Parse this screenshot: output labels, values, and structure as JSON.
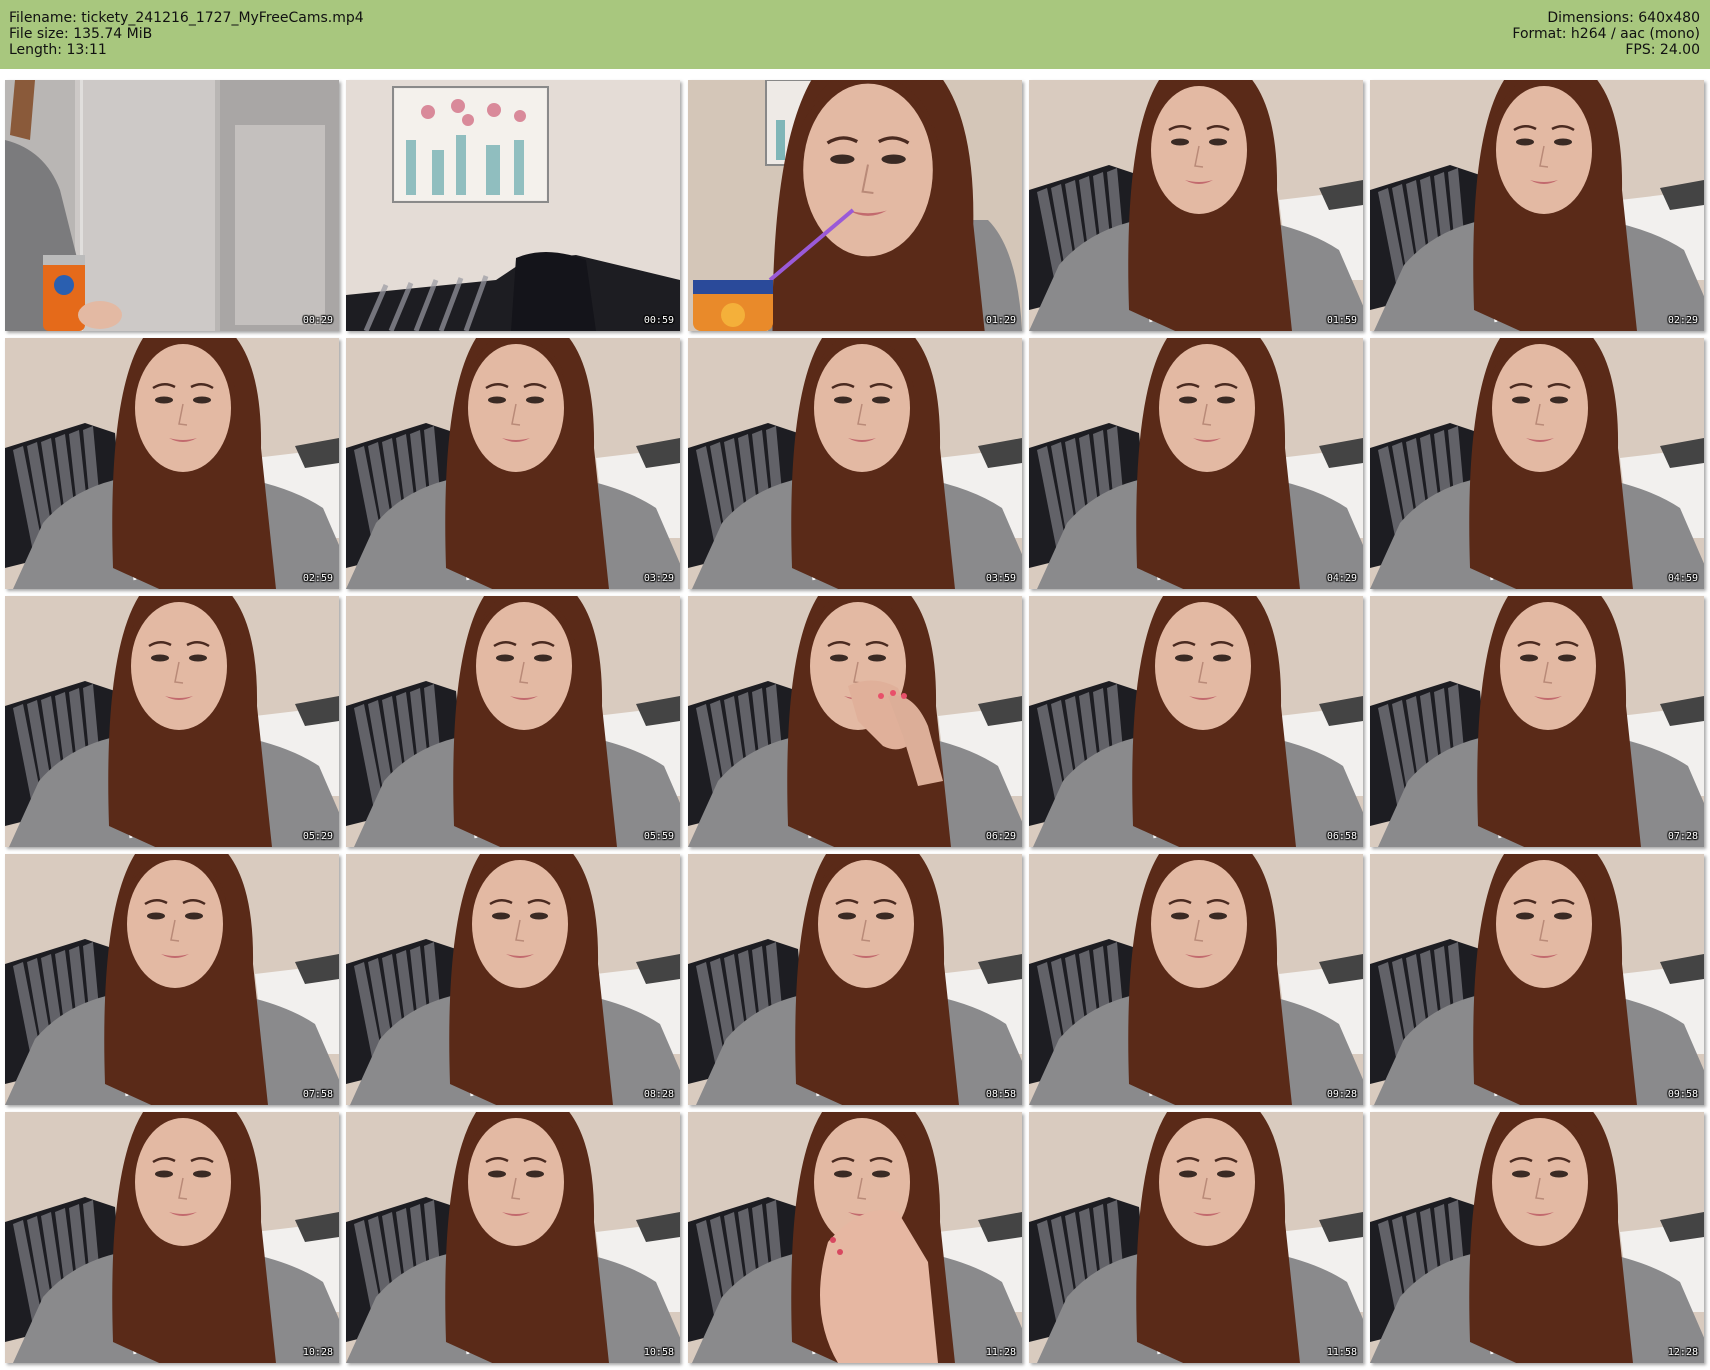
{
  "header": {
    "filename": "Filename: tickety_241216_1727_MyFreeCams.mp4",
    "filesize": "File size: 135.74 MiB",
    "length": "Length: 13:11",
    "dimensions": "Dimensions: 640x480",
    "format": "Format: h264 / aac (mono)",
    "fps": "FPS: 24.00"
  },
  "colors": {
    "header_bg": "#a8c77e",
    "wall": "#d9cbbf",
    "sofa": "#1d1d22",
    "hoodie": "#8a8a8c",
    "hair": "#5a2a18",
    "skin": "#e3b9a3"
  },
  "thumbnails": [
    {
      "time": "00:29",
      "scene": "arm-can"
    },
    {
      "time": "00:59",
      "scene": "room"
    },
    {
      "time": "01:29",
      "scene": "straw"
    },
    {
      "time": "01:59",
      "scene": "portrait"
    },
    {
      "time": "02:29",
      "scene": "portrait"
    },
    {
      "time": "02:59",
      "scene": "portrait"
    },
    {
      "time": "03:29",
      "scene": "portrait"
    },
    {
      "time": "03:59",
      "scene": "portrait"
    },
    {
      "time": "04:29",
      "scene": "portrait"
    },
    {
      "time": "04:59",
      "scene": "portrait"
    },
    {
      "time": "05:29",
      "scene": "portrait"
    },
    {
      "time": "05:59",
      "scene": "portrait"
    },
    {
      "time": "06:29",
      "scene": "hand-mouth"
    },
    {
      "time": "06:58",
      "scene": "portrait"
    },
    {
      "time": "07:28",
      "scene": "portrait"
    },
    {
      "time": "07:58",
      "scene": "portrait"
    },
    {
      "time": "08:28",
      "scene": "portrait"
    },
    {
      "time": "08:58",
      "scene": "portrait"
    },
    {
      "time": "09:28",
      "scene": "portrait"
    },
    {
      "time": "09:58",
      "scene": "portrait"
    },
    {
      "time": "10:28",
      "scene": "portrait"
    },
    {
      "time": "10:58",
      "scene": "portrait"
    },
    {
      "time": "11:28",
      "scene": "hand-face"
    },
    {
      "time": "11:58",
      "scene": "portrait"
    },
    {
      "time": "12:28",
      "scene": "portrait"
    }
  ]
}
